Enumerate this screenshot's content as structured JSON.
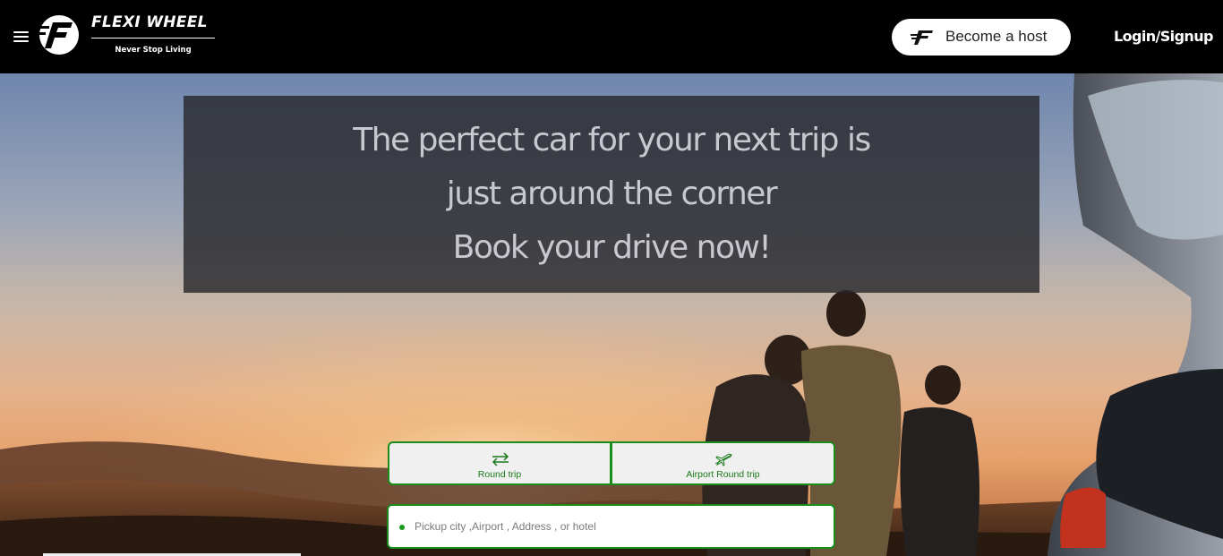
{
  "header": {
    "brand_name": "FLEXI WHEEL",
    "brand_tagline": "Never Stop Living",
    "menu_icon": "hamburger-menu-icon",
    "logo_icon": "flexi-wheel-logo",
    "host_button_label": "Become a host",
    "host_button_icon": "flexi-f-icon",
    "login_label": "Login/Signup"
  },
  "hero": {
    "headline_line1": "The perfect car for your next trip is",
    "headline_line2": "just around the corner",
    "headline_line3": "Book your drive now!"
  },
  "trip_types": [
    {
      "label": "Round trip",
      "icon": "swap-arrows-icon"
    },
    {
      "label": "Airport Round trip",
      "icon": "airplane-icon"
    }
  ],
  "search": {
    "pickup_placeholder": "Pickup city ,Airport , Address , or hotel",
    "pickup_value": ""
  },
  "colors": {
    "header_bg": "#000000",
    "accent_green": "#1a8c1a",
    "headline_text": "#c8c8d0"
  }
}
